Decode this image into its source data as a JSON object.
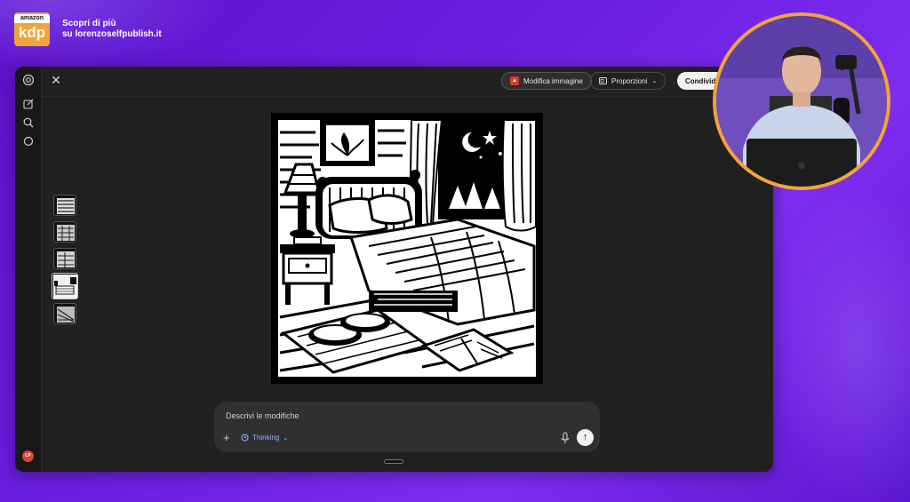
{
  "brand": {
    "logo_top": "amazon",
    "logo_main": "kdp",
    "line1": "Scopri di più",
    "line2": "su lorenzoselfpublish.it"
  },
  "toolbar": {
    "edit_image": "Modifica immagine",
    "proportions": "Proporzioni",
    "share": "Condividi"
  },
  "sidebar": {
    "avatar_initials": "LP"
  },
  "prompt": {
    "placeholder": "Descrivi le modifiche",
    "mode": "Thinking"
  },
  "colors": {
    "accent_orange": "#f2a33a",
    "background_purple": "#6a1fe0",
    "window": "#212121",
    "thinking_blue": "#8fb3ff"
  }
}
